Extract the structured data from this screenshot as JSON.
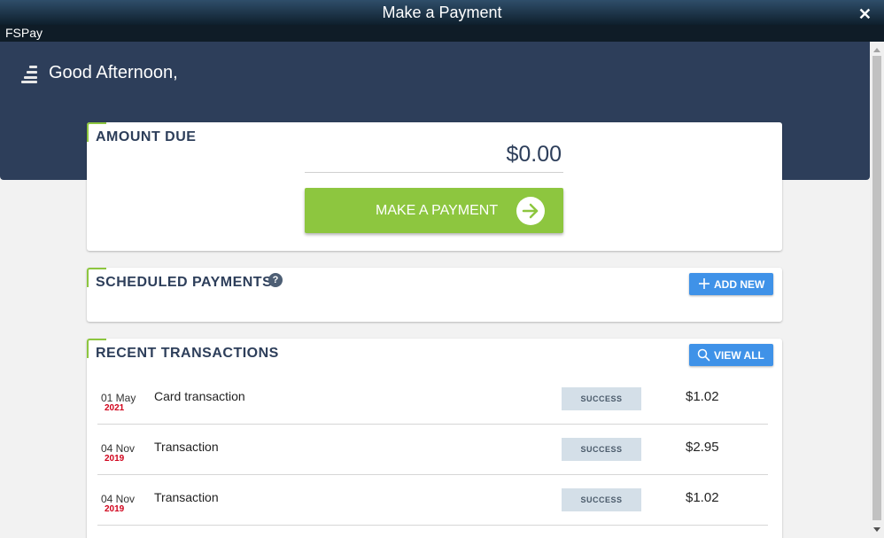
{
  "window": {
    "title": "Make a Payment",
    "close_icon": "close-icon"
  },
  "app": {
    "name": "FSPay"
  },
  "hero": {
    "greeting": "Good Afternoon,",
    "logo_icon": "stacked-bars-logo"
  },
  "amount_due": {
    "heading": "AMOUNT DUE",
    "value": "$0.00",
    "button_label": "MAKE A PAYMENT",
    "button_icon": "arrow-right-icon"
  },
  "scheduled": {
    "heading": "SCHEDULED PAYMENTS",
    "help_icon": "?",
    "add_label": "ADD NEW"
  },
  "recent": {
    "heading": "RECENT TRANSACTIONS",
    "view_all_label": "VIEW ALL",
    "transactions": [
      {
        "day": "01 May",
        "year": "2021",
        "name": "Card transaction",
        "status": "SUCCESS",
        "amount": "$1.02"
      },
      {
        "day": "04 Nov",
        "year": "2019",
        "name": "Transaction",
        "status": "SUCCESS",
        "amount": "$2.95"
      },
      {
        "day": "04 Nov",
        "year": "2019",
        "name": "Transaction",
        "status": "SUCCESS",
        "amount": "$1.02"
      }
    ]
  },
  "colors": {
    "header_dark": "#2d3e5a",
    "accent_green": "#8dc63f",
    "button_blue": "#3f92e8",
    "year_red": "#d0021b",
    "status_bg": "#d4dfe8"
  }
}
